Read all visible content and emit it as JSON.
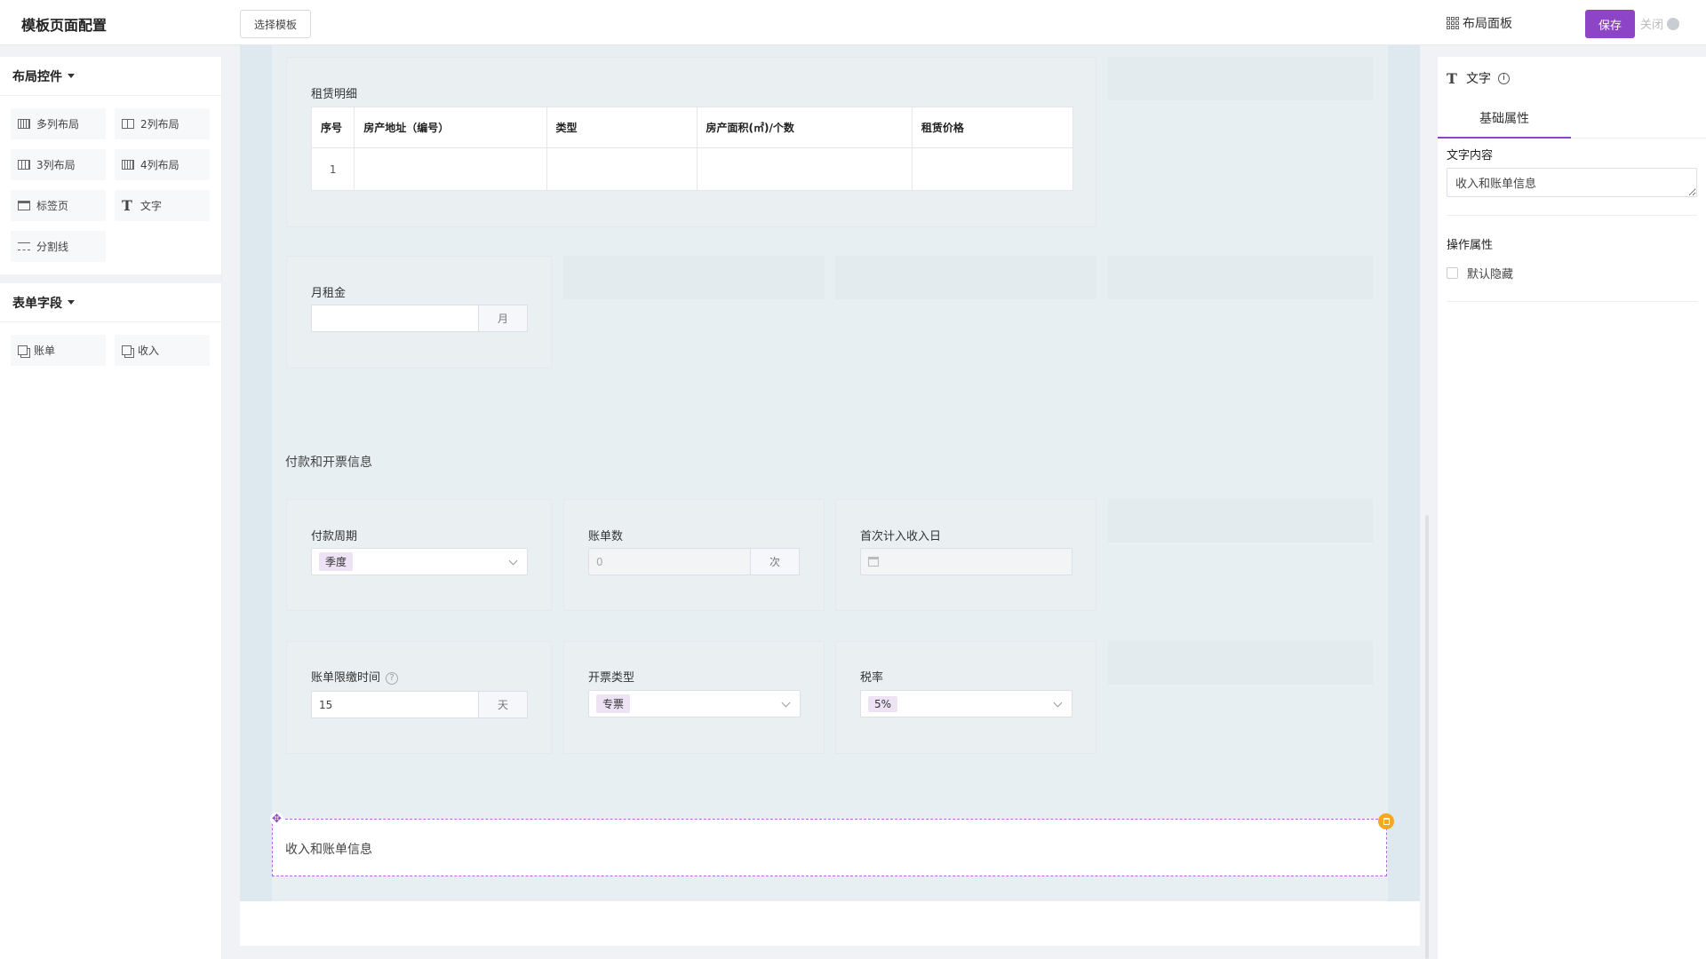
{
  "header": {
    "title": "模板页面配置",
    "select_template": "选择模板",
    "layout_panel": "布局面板",
    "save": "保存",
    "close": "关闭"
  },
  "left": {
    "layout_title": "布局控件",
    "layout_items": [
      "多列布局",
      "2列布局",
      "3列布局",
      "4列布局",
      "标签页",
      "文字",
      "分割线"
    ],
    "fields_title": "表单字段",
    "field_items": [
      "账单",
      "收入"
    ]
  },
  "canvas": {
    "rent_detail": {
      "title": "租赁明细",
      "columns": [
        "序号",
        "房产地址（编号）",
        "类型",
        "房产面积(㎡)/个数",
        "租赁价格"
      ],
      "rows": [
        [
          "1",
          "",
          "",
          "",
          ""
        ]
      ]
    },
    "monthly_rent": {
      "label": "月租金",
      "value": "",
      "unit": "月"
    },
    "payment_section": "付款和开票信息",
    "payment_cycle": {
      "label": "付款周期",
      "value": "季度"
    },
    "bill_count": {
      "label": "账单数",
      "placeholder": "0",
      "unit": "次"
    },
    "first_income_date": {
      "label": "首次计入收入日"
    },
    "bill_due": {
      "label": "账单限缴时间",
      "help": "?",
      "value": "15",
      "unit": "天"
    },
    "invoice_type": {
      "label": "开票类型",
      "value": "专票"
    },
    "tax_rate": {
      "label": "税率",
      "value": "5%"
    },
    "selected_text": "收入和账单信息"
  },
  "right": {
    "component": "文字",
    "tab": "基础属性",
    "text_content_label": "文字内容",
    "text_content_value": "收入和账单信息",
    "operation_label": "操作属性",
    "default_hidden": "默认隐藏"
  },
  "colors": {
    "accent": "#8e44c6",
    "delete": "#f5a623"
  }
}
